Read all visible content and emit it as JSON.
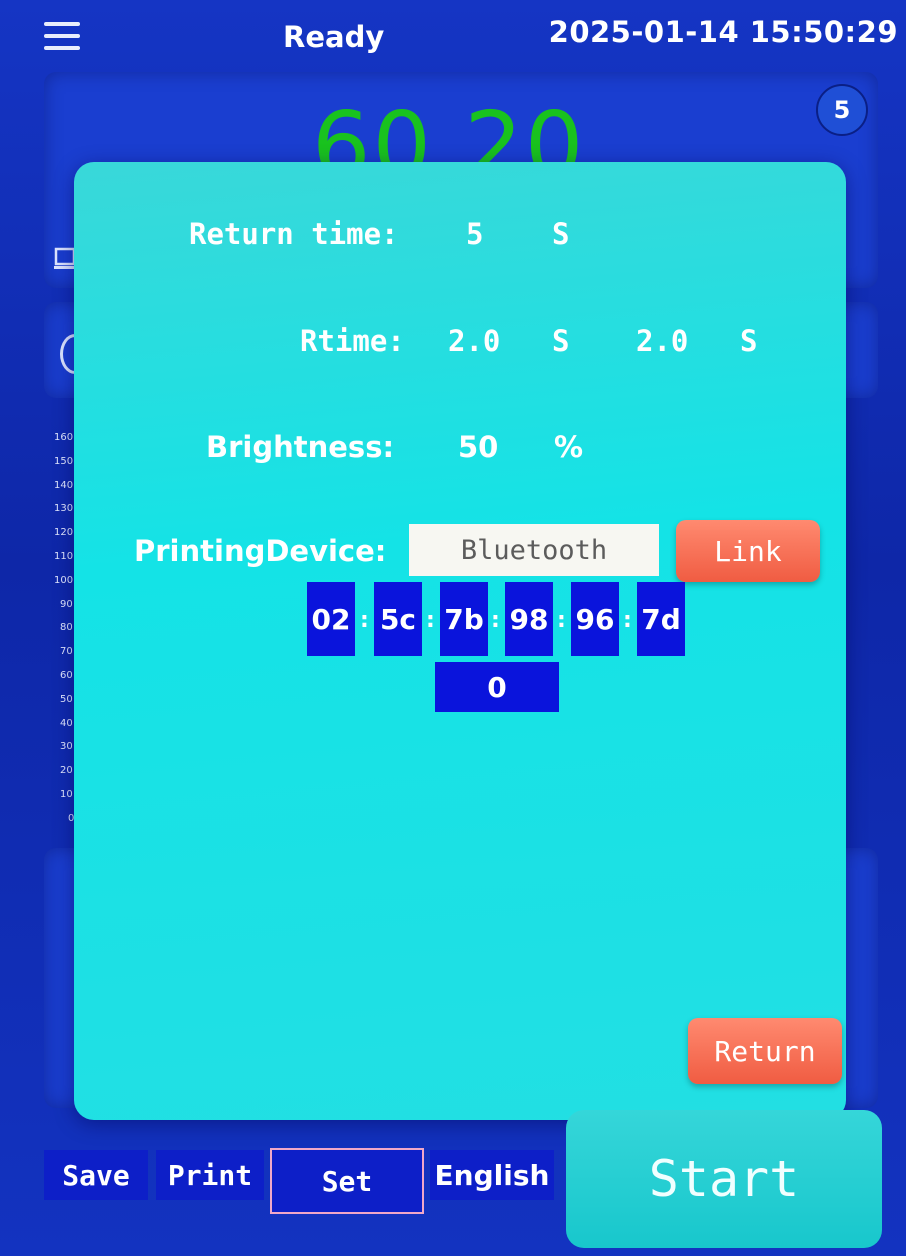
{
  "header": {
    "status": "Ready",
    "datetime": "2025-01-14  15:50:29"
  },
  "background": {
    "badge": "5",
    "big_number": "60  20",
    "axis_ticks": [
      "160",
      "150",
      "140",
      "130",
      "120",
      "110",
      "100",
      "90",
      "80",
      "70",
      "60",
      "50",
      "40",
      "30",
      "20",
      "10",
      "0"
    ]
  },
  "dialog": {
    "return_time": {
      "label": "Return time:",
      "value": "5",
      "unit": "S"
    },
    "rtime": {
      "label": "Rtime:",
      "value1": "2.0",
      "unit1": "S",
      "value2": "2.0",
      "unit2": "S"
    },
    "brightness": {
      "label": "Brightness:",
      "value": "50",
      "unit": "%"
    },
    "printing_device": {
      "label": "PrintingDevice:",
      "value": "Bluetooth",
      "link_label": "Link"
    },
    "mac": [
      "02",
      "5c",
      "7b",
      "98",
      "96",
      "7d"
    ],
    "mac_separator": ":",
    "device_index": "0",
    "return_label": "Return"
  },
  "toolbar": {
    "save": "Save",
    "print": "Print",
    "set": "Set",
    "language": "English",
    "start": "Start"
  },
  "colors": {
    "background": "#1535c4",
    "dialog": "#22dfe3",
    "accent_orange": "#f05c42",
    "mac_cell": "#0a14dc",
    "big_number": "#19c21e"
  }
}
